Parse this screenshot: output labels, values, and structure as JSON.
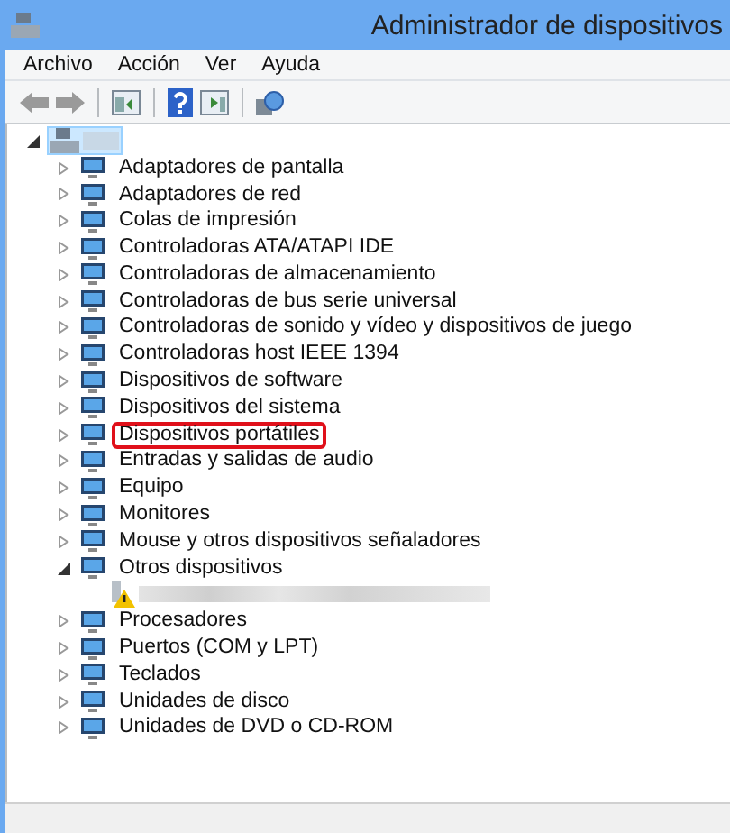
{
  "window": {
    "title": "Administrador de dispositivos"
  },
  "menu": [
    "Archivo",
    "Acción",
    "Ver",
    "Ayuda"
  ],
  "tree": {
    "selected": true,
    "expanded": true,
    "children": [
      {
        "label": "Adaptadores de pantalla",
        "expanded": false,
        "highlighted": false
      },
      {
        "label": "Adaptadores de red",
        "expanded": false,
        "highlighted": false
      },
      {
        "label": "Colas de impresión",
        "expanded": false,
        "highlighted": false
      },
      {
        "label": "Controladoras ATA/ATAPI IDE",
        "expanded": false,
        "highlighted": false
      },
      {
        "label": "Controladoras de almacenamiento",
        "expanded": false,
        "highlighted": false
      },
      {
        "label": "Controladoras de bus serie universal",
        "expanded": false,
        "highlighted": false
      },
      {
        "label": "Controladoras de sonido y vídeo y dispositivos de juego",
        "expanded": false,
        "highlighted": false
      },
      {
        "label": "Controladoras host IEEE 1394",
        "expanded": false,
        "highlighted": false
      },
      {
        "label": "Dispositivos de software",
        "expanded": false,
        "highlighted": false
      },
      {
        "label": "Dispositivos del sistema",
        "expanded": false,
        "highlighted": false
      },
      {
        "label": "Dispositivos portátiles",
        "expanded": false,
        "highlighted": true
      },
      {
        "label": "Entradas y salidas de audio",
        "expanded": false,
        "highlighted": false
      },
      {
        "label": "Equipo",
        "expanded": false,
        "highlighted": false
      },
      {
        "label": "Monitores",
        "expanded": false,
        "highlighted": false
      },
      {
        "label": "Mouse y otros dispositivos señaladores",
        "expanded": false,
        "highlighted": false
      },
      {
        "label": "Otros dispositivos",
        "expanded": true,
        "highlighted": false,
        "children": [
          {
            "warning": true
          }
        ]
      },
      {
        "label": "Procesadores",
        "expanded": false,
        "highlighted": false
      },
      {
        "label": "Puertos (COM y LPT)",
        "expanded": false,
        "highlighted": false
      },
      {
        "label": "Teclados",
        "expanded": false,
        "highlighted": false
      },
      {
        "label": "Unidades de disco",
        "expanded": false,
        "highlighted": false
      },
      {
        "label": "Unidades de DVD o CD-ROM",
        "expanded": false,
        "highlighted": false
      }
    ]
  }
}
